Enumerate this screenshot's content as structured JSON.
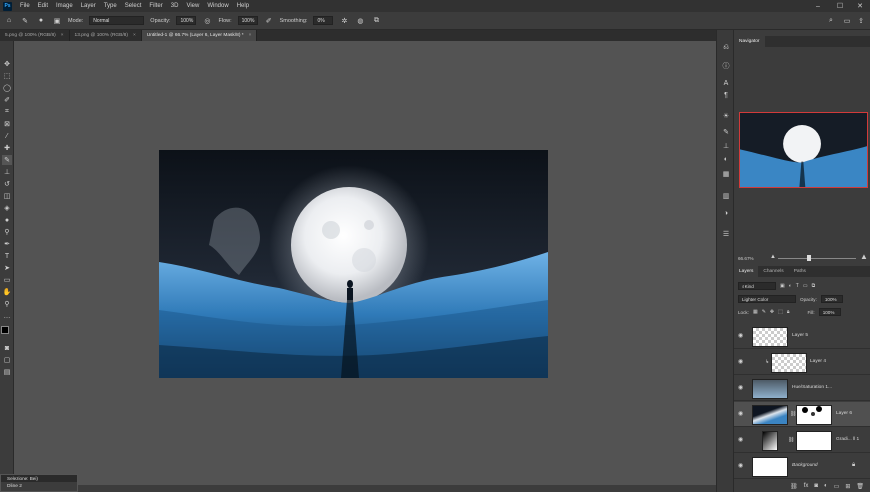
{
  "menubar": {
    "logo": "Ps",
    "items": [
      "File",
      "Edit",
      "Image",
      "Layer",
      "Type",
      "Select",
      "Filter",
      "3D",
      "View",
      "Window",
      "Help"
    ]
  },
  "options": {
    "mode_label": "Mode:",
    "mode_value": "Normal",
    "opacity_label": "Opacity:",
    "opacity_value": "100%",
    "flow_label": "Flow:",
    "flow_value": "100%",
    "smoothing_label": "Smoothing:",
    "smoothing_value": "0%"
  },
  "tabs": [
    {
      "label": "5.png @ 100% (RGB/8)",
      "close": "×"
    },
    {
      "label": "13.png @ 100% (RGB/8)",
      "close": "×"
    },
    {
      "label": "Untitled-1 @ 66.7% (Layer 6, Layer Mask/8) *",
      "close": "×"
    }
  ],
  "navigator": {
    "title": "Navigator",
    "zoom": "66.67%"
  },
  "layers_panel": {
    "tabs": [
      "Layers",
      "Channels",
      "Paths"
    ],
    "filter_kind": "Kind",
    "blend_mode": "Lighter Color",
    "opacity_label": "Opacity:",
    "opacity_value": "100%",
    "lock_label": "Lock:",
    "fill_label": "Fill:",
    "fill_value": "100%",
    "layers": [
      {
        "name": "Layer 5"
      },
      {
        "name": "Layer 4"
      },
      {
        "name": "Hue/Saturation 1..."
      },
      {
        "name": "Layer 6"
      },
      {
        "name": "Gradi... ll 1"
      },
      {
        "name": "Background"
      }
    ]
  },
  "float_panel": {
    "title": "Selezione: Bei)",
    "value": "Dline 2"
  },
  "colors": {
    "panel": "#3c3c3c",
    "canvas": "#535353",
    "accent": "#d23a3a"
  }
}
